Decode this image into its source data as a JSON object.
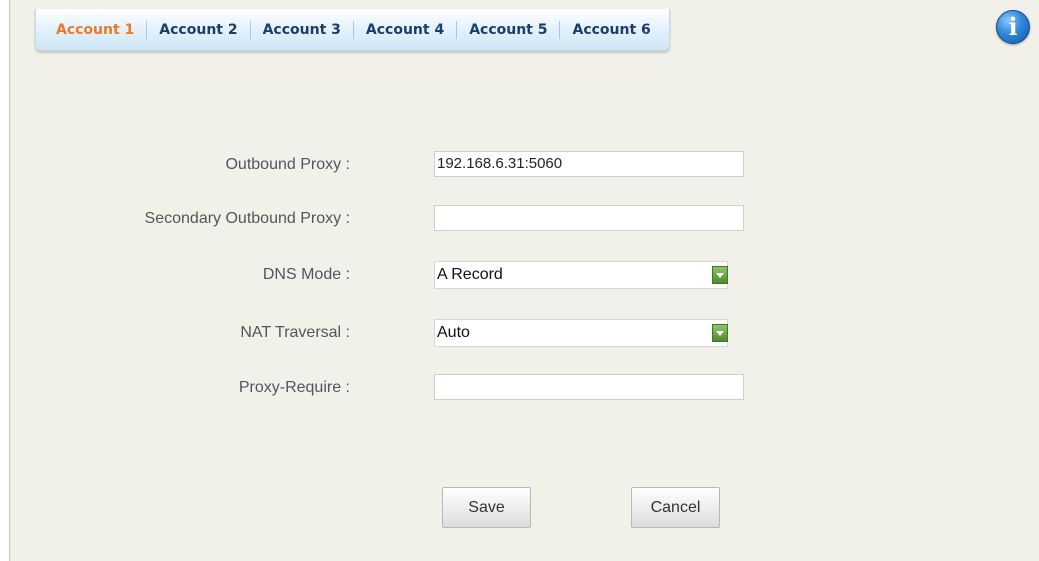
{
  "tabs": [
    {
      "label": "Account 1",
      "active": true
    },
    {
      "label": "Account 2",
      "active": false
    },
    {
      "label": "Account 3",
      "active": false
    },
    {
      "label": "Account 4",
      "active": false
    },
    {
      "label": "Account 5",
      "active": false
    },
    {
      "label": "Account 6",
      "active": false
    }
  ],
  "info_icon": {
    "glyph": "i",
    "icon": "info-icon"
  },
  "form": {
    "outbound_proxy": {
      "label": "Outbound Proxy :",
      "value": "192.168.6.31:5060"
    },
    "secondary_outbound_proxy": {
      "label": "Secondary Outbound Proxy :",
      "value": ""
    },
    "dns_mode": {
      "label": "DNS Mode :",
      "selected": "A Record"
    },
    "nat_traversal": {
      "label": "NAT Traversal :",
      "selected": "Auto"
    },
    "proxy_require": {
      "label": "Proxy-Require :",
      "value": ""
    }
  },
  "buttons": {
    "save_label": "Save",
    "cancel_label": "Cancel"
  },
  "colors": {
    "active_tab": "#e87a2a",
    "tab_text": "#1b3e6d",
    "panel_bg": "#f1f1ea",
    "dropdown_arrow": "#5a9a38"
  }
}
